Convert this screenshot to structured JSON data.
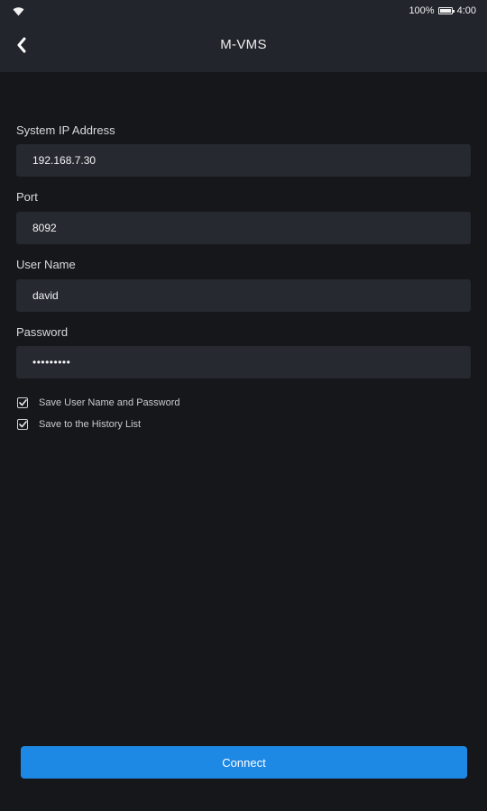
{
  "status_bar": {
    "wifi_icon": "wifi-icon",
    "battery_percent": "100%",
    "battery_level": 1.0,
    "time": "4:00"
  },
  "app_bar": {
    "back_icon": "chevron-left-icon",
    "title": "M-VMS"
  },
  "form": {
    "ip": {
      "label": "System IP Address",
      "value": "192.168.7.30"
    },
    "port": {
      "label": "Port",
      "value": "8092"
    },
    "username": {
      "label": "User Name",
      "value": "david"
    },
    "password": {
      "label": "Password",
      "value": "•••••••••"
    }
  },
  "options": {
    "save_credentials": {
      "label": "Save User Name and Password",
      "checked": true
    },
    "save_history": {
      "label": "Save to the History List",
      "checked": true
    }
  },
  "connect_button": {
    "label": "Connect"
  },
  "colors": {
    "background": "#16171b",
    "appbar": "#23252d",
    "field_bg": "#262930",
    "accent": "#1e88e5"
  }
}
